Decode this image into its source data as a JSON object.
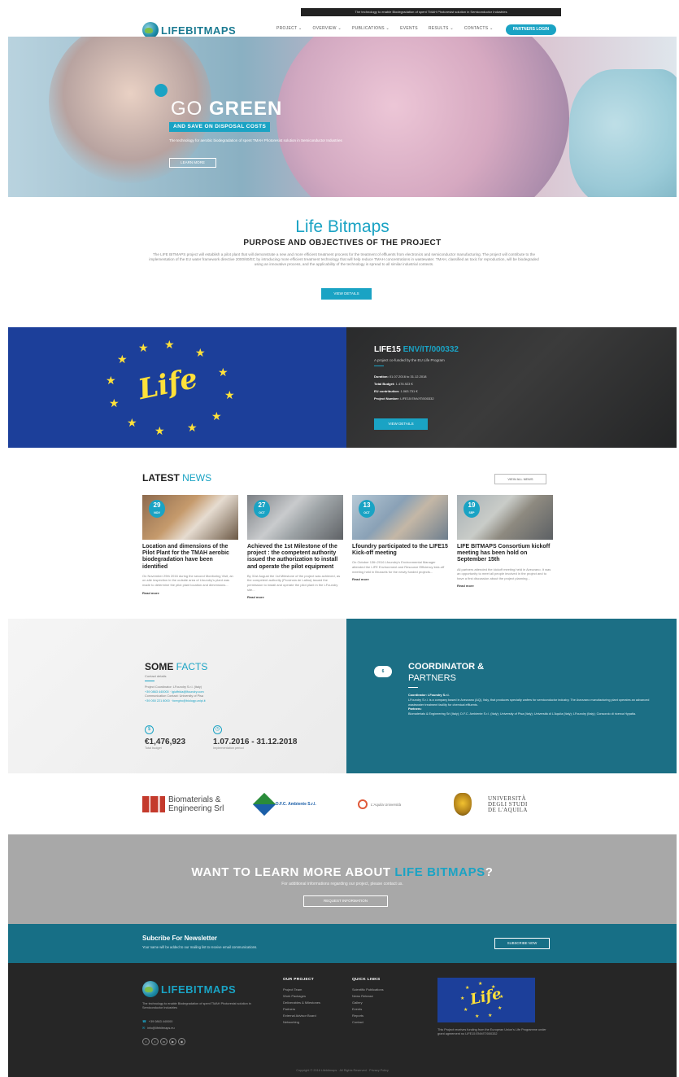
{
  "top_strip": "The technology to enable Biodegradation of spent TMAH Photoresist solution in Semiconductor Industries",
  "header": {
    "logo": "LIFEBITMAPS",
    "nav": [
      "PROJECT ⌄",
      "OVERVIEW ⌄",
      "PUBLICATIONS ⌄",
      "EVENTS",
      "RESULTS ⌄",
      "CONTACTS ⌄"
    ],
    "cta": "PARTNERS LOGIN"
  },
  "hero": {
    "title_light": "GO ",
    "title_bold": "GREEN",
    "badge": "AND SAVE ON DISPOSAL COSTS",
    "subtitle": "The technology for aerobic biodegradation of spent TMAH Photoresist solution in Semiconductor Industries",
    "button": "LEARN MORE"
  },
  "intro": {
    "title": "Life Bitmaps",
    "subtitle": "PURPOSE AND OBJECTIVES OF THE PROJECT",
    "body": "The LIFE BITMAPS project will establish a pilot plant that will demonstrate a new and more efficient treatment process for the treatment of effluents from electronics and semiconductor manufacturing. The project will contribute to the implementation of the EU water framework directive 2000/60/EC by introducing more efficient treatment technology that will help reduce TMAH concentrations in wastewater. TMAH, classified as toxic for reproduction, will be biodegraded using an innovative process, and the applicability of the technology is spread to all similar industrial contexts.",
    "button": "VIEW DETAILS"
  },
  "life": {
    "word": "Life",
    "code_prefix": "LIFE15 ",
    "code_accent": "ENV/IT/000332",
    "funded": "A project co-funded by the EU Life Program",
    "info": [
      {
        "label": "Duration:",
        "value": "01.07.2016 to 31.12.2018"
      },
      {
        "label": "Total Budget:",
        "value": "1.476.923 €"
      },
      {
        "label": "EU contribution:",
        "value": "1.063.731 €"
      },
      {
        "label": "Project Number:",
        "value": "LIFE15 ENV/IT/000332"
      }
    ],
    "button": "VIEW DETAILS"
  },
  "news": {
    "title_bold": "LATEST ",
    "title_light": "NEWS",
    "view_all": "VIEW ALL NEWS",
    "cards": [
      {
        "day": "29",
        "month": "NOV",
        "title": "Location and dimensions of the Pilot Plant for the TMAH aerobic biodegradation have been identified",
        "text": "On November 29th 2016 during the second Monitoring Visit, an on-site inspection in the outside area of Lfoundry's plant was made to determine the pilot plant location and dimensions...",
        "more": "Read more"
      },
      {
        "day": "27",
        "month": "OCT",
        "title": "Achieved the 1st Milestone of the project : the competent authority issued the authorization to install and operate the pilot equipment",
        "text": "By 31st August the 1st Milestone of the project was achieved, as the competent authority (Provincia de Latina) issued the permission to install and operate the pilot plant in the LFoundry site...",
        "more": "Read more"
      },
      {
        "day": "13",
        "month": "OCT",
        "title": "Lfoundry participated to the LIFE15 Kick-off meeting",
        "text": "On October 13th 2016 Lfoundry's Environmental Manager attended the LIFE Environment and Resource Efficiency kick-off meeting held in Brussels for the newly funded projects...",
        "more": "Read more"
      },
      {
        "day": "19",
        "month": "SEP",
        "title": "LIFE BITMAPS Consortium kickoff meeting has been hold on September 15th",
        "text": "All partners attended the kickoff meeting held in Avezzano. It was an opportunity to meet all people involved in the project and to have a first discussion about the project planning...",
        "more": "Read more"
      }
    ]
  },
  "facts": {
    "title_bold": "SOME ",
    "title_light": "FACTS",
    "subtitle": "Contact details",
    "lines": [
      "Project Coordinator: LFoundry S.r.l. (Italy)",
      "+39 0863 440000 · lgiuffrida@lfoundry.com",
      "Communication Contact: University of Pisa",
      "+39 050 221 8000 · foregiro@biology.unipi.it"
    ],
    "stats": [
      {
        "icon": "$",
        "value": "€1,476,923",
        "label": "Total budget"
      },
      {
        "icon": "◷",
        "value": "1.07.2016 - 31.12.2018",
        "label": "Implementation period"
      }
    ]
  },
  "coordinator": {
    "badge": "6",
    "title_bold": "COORDINATOR",
    "title_amp": " &",
    "title_light": "PARTNERS",
    "text_lead": "Coordinator: LFoundry S.r.l.",
    "text_1": "LFoundry S.r.l. is a company based in Avezzano (AQ), Italy, that produces specialty wafers for semiconductor industry. The Avezzano manufacturing plant operates an advanced wastewater treatment facility for chemical effluents.",
    "text_lead2": "Partners:",
    "text_2": "Biomaterials & Engineering Srl (Italy); D.F.C. Ambiente S.r.l. (Italy); University of Pisa (Italy); Università di L'Aquila (Italy); LFoundry (Italy); Consorzio di ricerca Hypatia."
  },
  "partners": {
    "bio": "Biomaterials &\nEngineering Srl",
    "dfc": "D.F.C. Ambiente S.r.l.",
    "cap": "L'Aquila Università",
    "uni": "UNIVERSITÀ\nDEGLI STUDI\nDE L'AQUILA"
  },
  "cta": {
    "title_light": "WANT TO LEARN MORE ABOUT ",
    "title_accent": "LIFE BITMAPS",
    "title_end": "?",
    "subtitle": "For additional informations regarding our project, please contact us.",
    "button": "REQUEST INFORMATION"
  },
  "newsletter": {
    "title": "Subcribe For Newsletter",
    "subtitle": "Your name will be added to our mailing list to receive email communications.",
    "button": "SUBSCRIBE NOW"
  },
  "footer": {
    "logo": "LIFEBITMAPS",
    "desc": "The technology to enable Biodegradation of spent TMAH Photoresist solution in Semiconductor Industries",
    "phone": "+39 0863 440000",
    "email": "info@lifebitmaps.eu",
    "col1_title": "OUR PROJECT",
    "col1": [
      "Project Team",
      "Work Packages",
      "Deliverables & Milestones",
      "Partners",
      "External Advisor Board",
      "Networking"
    ],
    "col2_title": "QUICK LINKS",
    "col2": [
      "Scientific Publications",
      "News Release",
      "Gallery",
      "Events",
      "Reports",
      "Contact"
    ],
    "flag_word": "Life",
    "flag_text": "This Project receives funding from the European Union's Life Programme under grant agreement no LIFE15 ENV/IT/000332",
    "bottom": "Copyright © 2016 Lifebitmaps · All Rights Reserved · Privacy Policy"
  }
}
